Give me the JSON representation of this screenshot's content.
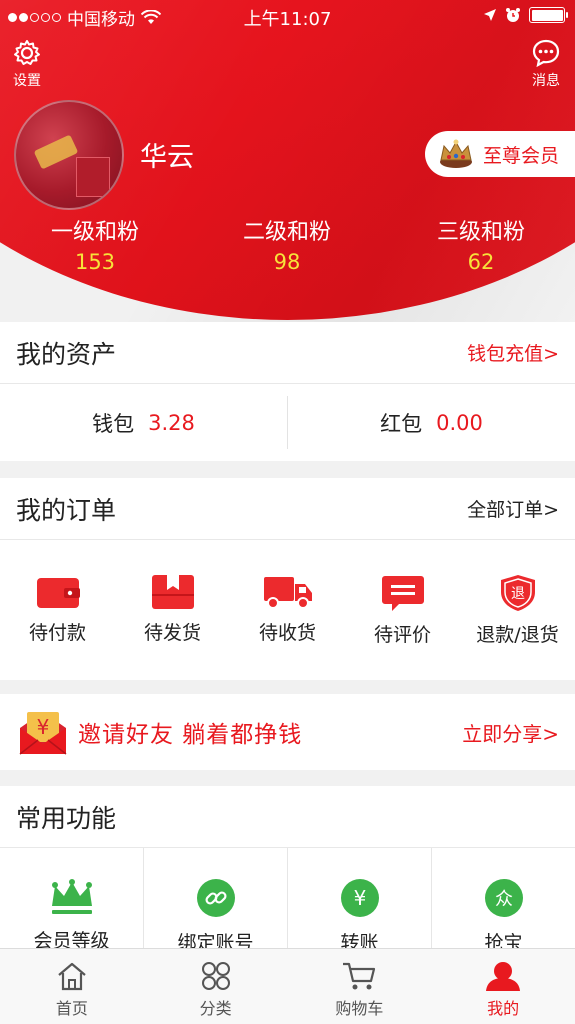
{
  "status_bar": {
    "carrier": "中国移动",
    "time": "上午11:07"
  },
  "header": {
    "settings_label": "设置",
    "messages_label": "消息",
    "username": "华云",
    "vip_label": "至尊会员",
    "fans": [
      {
        "label": "一级和粉",
        "count": "153"
      },
      {
        "label": "二级和粉",
        "count": "98"
      },
      {
        "label": "三级和粉",
        "count": "62"
      }
    ]
  },
  "assets": {
    "title": "我的资产",
    "link": "钱包充值>",
    "wallet_label": "钱包",
    "wallet_value": "3.28",
    "redpacket_label": "红包",
    "redpacket_value": "0.00"
  },
  "orders": {
    "title": "我的订单",
    "link": "全部订单>",
    "items": [
      {
        "label": "待付款",
        "icon": "wallet-icon"
      },
      {
        "label": "待发货",
        "icon": "box-icon"
      },
      {
        "label": "待收货",
        "icon": "truck-icon"
      },
      {
        "label": "待评价",
        "icon": "comment-icon"
      },
      {
        "label": "退款/退货",
        "icon": "refund-shield-icon"
      }
    ]
  },
  "invite": {
    "text": "邀请好友  躺着都挣钱",
    "link": "立即分享>"
  },
  "functions": {
    "title": "常用功能",
    "items": [
      {
        "label": "会员等级",
        "icon": "crown-icon"
      },
      {
        "label": "绑定账号",
        "icon": "link-icon"
      },
      {
        "label": "转账",
        "icon": "yuan-icon"
      },
      {
        "label": "抢宝",
        "icon": "crowd-icon"
      }
    ]
  },
  "tabbar": {
    "items": [
      {
        "label": "首页",
        "icon": "home-icon"
      },
      {
        "label": "分类",
        "icon": "category-icon"
      },
      {
        "label": "购物车",
        "icon": "cart-icon"
      },
      {
        "label": "我的",
        "icon": "profile-icon"
      }
    ]
  },
  "colors": {
    "brand_red": "#e8191f",
    "accent_yellow": "#f7e23a",
    "function_green": "#3cb34a"
  }
}
